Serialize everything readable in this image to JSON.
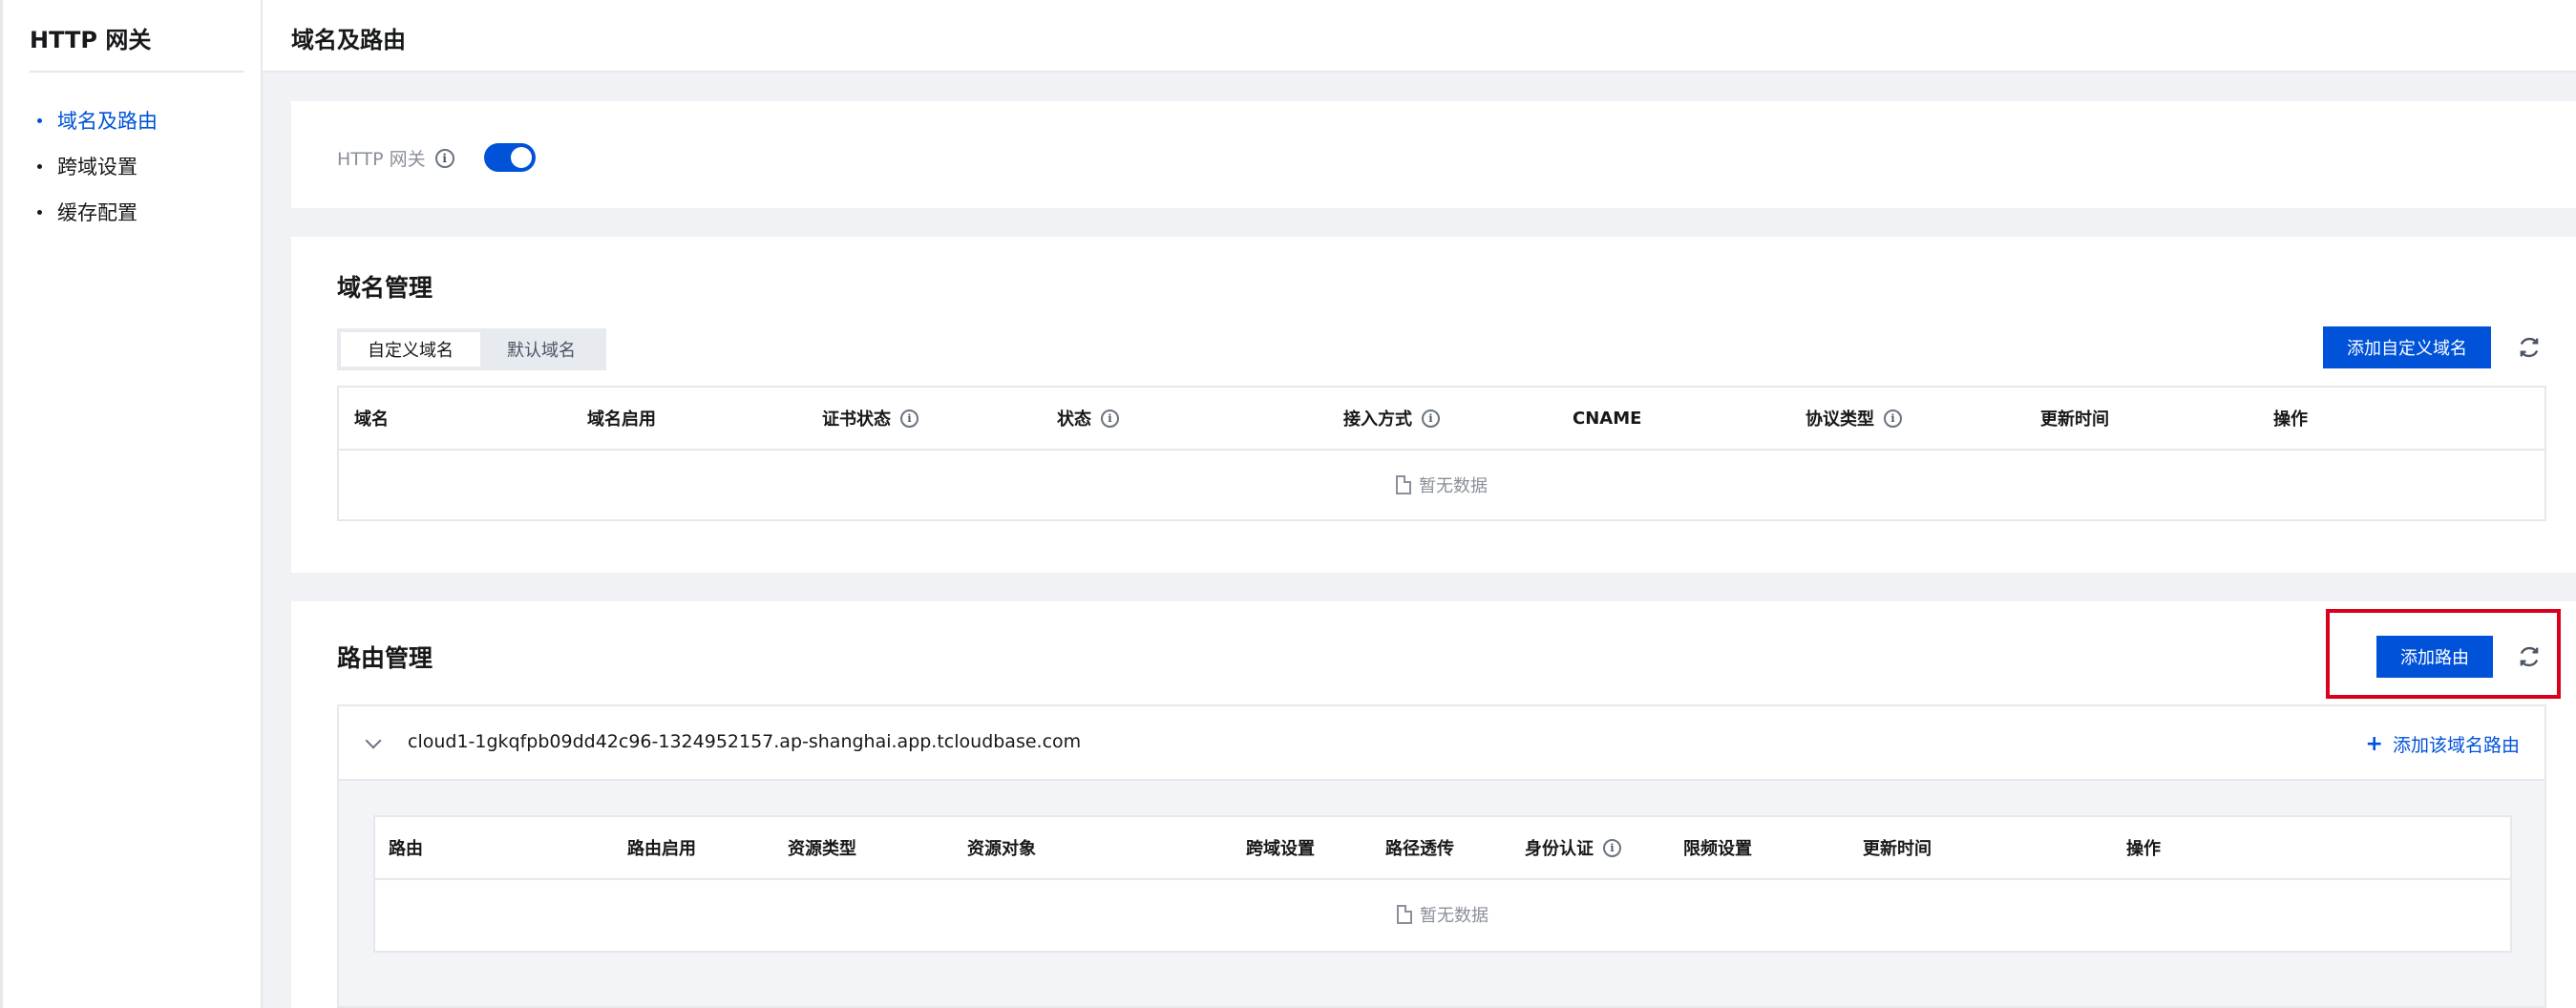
{
  "sidebar": {
    "title": "HTTP 网关",
    "items": [
      {
        "label": "域名及路由",
        "active": true
      },
      {
        "label": "跨域设置",
        "active": false
      },
      {
        "label": "缓存配置",
        "active": false
      }
    ]
  },
  "header": {
    "title": "域名及路由"
  },
  "gateway": {
    "label": "HTTP 网关",
    "enabled": true
  },
  "domain_section": {
    "title": "域名管理",
    "tabs": [
      "自定义域名",
      "默认域名"
    ],
    "active_tab": "自定义域名",
    "add_button": "添加自定义域名",
    "columns": [
      "域名",
      "域名启用",
      "证书状态",
      "状态",
      "接入方式",
      "CNAME",
      "协议类型",
      "更新时间",
      "操作"
    ],
    "empty_text": "暂无数据"
  },
  "route_section": {
    "title": "路由管理",
    "add_button": "添加路由",
    "domain": "cloud1-1gkqfpb09dd42c96-1324952157.ap-shanghai.app.tcloudbase.com",
    "add_domain_route": "添加该域名路由",
    "columns": [
      "路由",
      "路由启用",
      "资源类型",
      "资源对象",
      "跨域设置",
      "路径透传",
      "身份认证",
      "限频设置",
      "更新时间",
      "操作"
    ],
    "empty_text": "暂无数据"
  },
  "colors": {
    "primary": "#0052d9",
    "highlight": "#d9001b"
  }
}
